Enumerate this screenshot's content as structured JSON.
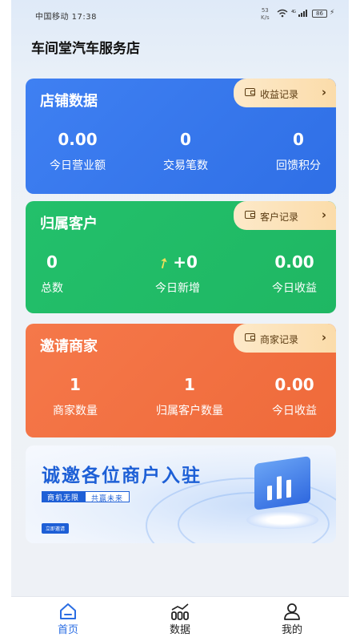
{
  "status_bar": {
    "carrier": "中国移动 17:38",
    "speed_top": "53",
    "speed_unit": "K/s",
    "network": "4G",
    "battery": "86"
  },
  "header": {
    "title": "车间堂汽车服务店"
  },
  "store_card": {
    "title": "店铺数据",
    "record_label": "收益记录",
    "stats": [
      {
        "value": "0.00",
        "label": "今日营业额"
      },
      {
        "value": "0",
        "label": "交易笔数"
      },
      {
        "value": "0",
        "label": "回馈积分"
      }
    ],
    "color": "#3a7bf0"
  },
  "customer_card": {
    "title": "归属客户",
    "record_label": "客户记录",
    "stats": [
      {
        "value": "0",
        "label": "总数"
      },
      {
        "value": "+0",
        "label": "今日新增"
      },
      {
        "value": "0.00",
        "label": "今日收益"
      }
    ],
    "color": "#22bd68"
  },
  "merchant_card": {
    "title": "邀请商家",
    "record_label": "商家记录",
    "stats": [
      {
        "value": "1",
        "label": "商家数量"
      },
      {
        "value": "1",
        "label": "归属客户数量"
      },
      {
        "value": "0.00",
        "label": "今日收益"
      }
    ],
    "color": "#f27344"
  },
  "banner": {
    "title": "诚邀各位商户入驻",
    "tag1": "商机无限",
    "tag2": "共赢未来",
    "button": "立即邀请"
  },
  "tabbar": {
    "items": [
      {
        "label": "首页",
        "icon": "home-icon"
      },
      {
        "label": "数据",
        "icon": "chart-icon"
      },
      {
        "label": "我的",
        "icon": "user-icon"
      }
    ],
    "active_color": "#2a6de3"
  }
}
